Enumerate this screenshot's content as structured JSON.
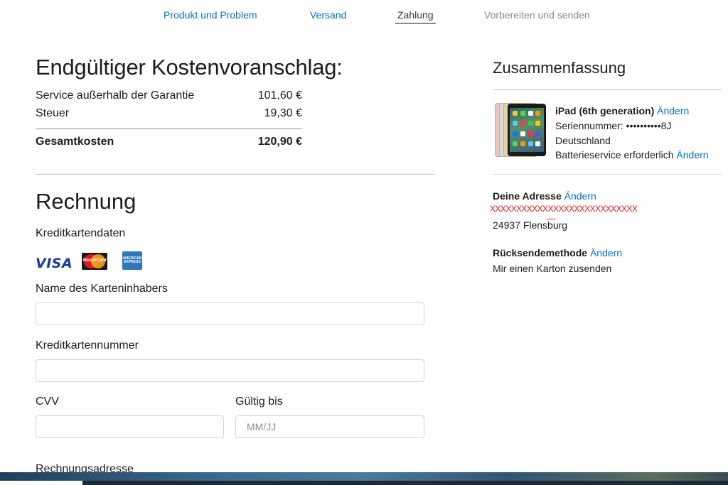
{
  "steps": [
    {
      "label": "Produkt und Problem"
    },
    {
      "label": "Versand"
    },
    {
      "label": "Zahlung"
    },
    {
      "label": "Vorbereiten und senden"
    }
  ],
  "estimate": {
    "title": "Endgültiger Kostenvoranschlag:",
    "rows": [
      {
        "label": "Service außerhalb der Garantie",
        "value": "101,60 €"
      },
      {
        "label": "Steuer",
        "value": "19,30 €"
      }
    ],
    "total": {
      "label": "Gesamtkosten",
      "value": "120,90 €"
    }
  },
  "billing": {
    "title": "Rechnung",
    "card_data_label": "Kreditkartendaten",
    "card_brands": {
      "visa": "VISA",
      "mastercard": "MasterCard",
      "amex": "AMERICAN EXPRESS"
    },
    "name_label": "Name des Karteninhabers",
    "name_value": "",
    "number_label": "Kreditkartennummer",
    "number_value": "",
    "cvv_label": "CVV",
    "cvv_value": "",
    "expiry_label": "Gültig bis",
    "expiry_placeholder": "MM/JJ",
    "address_label": "Rechnungsadresse"
  },
  "summary": {
    "title": "Zusammenfassung",
    "device": {
      "name": "iPad (6th generation)",
      "serial": "Seriennummer: ••••••••••8J",
      "country": "Deutschland",
      "issue": "Batterieservice erforderlich"
    },
    "change_label": "Ändern",
    "address_title": "Deine Adresse",
    "address_redacted": "XXXXXXXXXXXXXXXXXXXXXXXXXXXX",
    "address_city": "24937 Flensburg",
    "return_title": "Rücksendemethode",
    "return_value": "Mir einen Karton zusenden"
  },
  "colors": {
    "link": "#0070c9",
    "text": "#1d1d1f",
    "redaction": "#e8111b"
  }
}
